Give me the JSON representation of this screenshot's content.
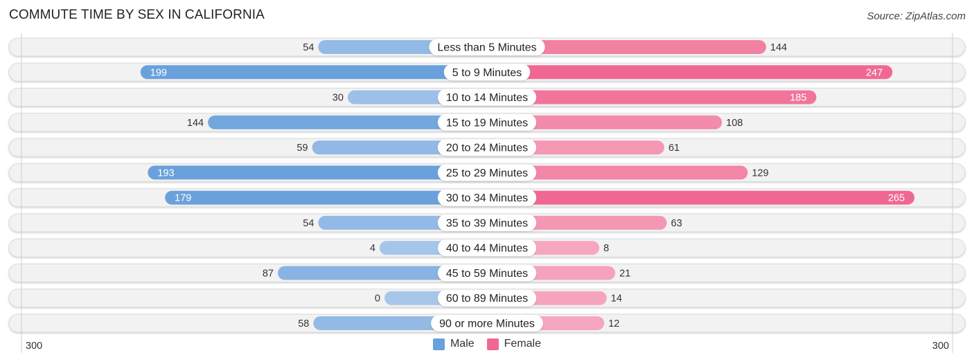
{
  "header": {
    "title": "COMMUTE TIME BY SEX IN CALIFORNIA",
    "source": "Source: ZipAtlas.com"
  },
  "colors": {
    "male": "#6aa1dc",
    "male_light": "#a6c6ea",
    "female": "#f06892",
    "female_light": "#f6a9c0",
    "track": "#f2f2f2"
  },
  "legend": [
    {
      "label": "Male",
      "color": "#6aa1dc"
    },
    {
      "label": "Female",
      "color": "#f06892"
    }
  ],
  "chart_data": {
    "type": "bar",
    "orientation": "horizontal-diverging",
    "title": "COMMUTE TIME BY SEX IN CALIFORNIA",
    "xlabel": "",
    "ylabel": "",
    "axis_min_label": "300",
    "axis_max_label": "300",
    "xlim": [
      -300,
      300
    ],
    "legend_position": "bottom-center",
    "categories": [
      "Less than 5 Minutes",
      "5 to 9 Minutes",
      "10 to 14 Minutes",
      "15 to 19 Minutes",
      "20 to 24 Minutes",
      "25 to 29 Minutes",
      "30 to 34 Minutes",
      "35 to 39 Minutes",
      "40 to 44 Minutes",
      "45 to 59 Minutes",
      "60 to 89 Minutes",
      "90 or more Minutes"
    ],
    "series": [
      {
        "name": "Male",
        "values": [
          54,
          199,
          30,
          144,
          59,
          193,
          179,
          54,
          4,
          87,
          0,
          58
        ]
      },
      {
        "name": "Female",
        "values": [
          144,
          247,
          185,
          108,
          61,
          129,
          265,
          63,
          8,
          21,
          14,
          12
        ]
      }
    ]
  }
}
